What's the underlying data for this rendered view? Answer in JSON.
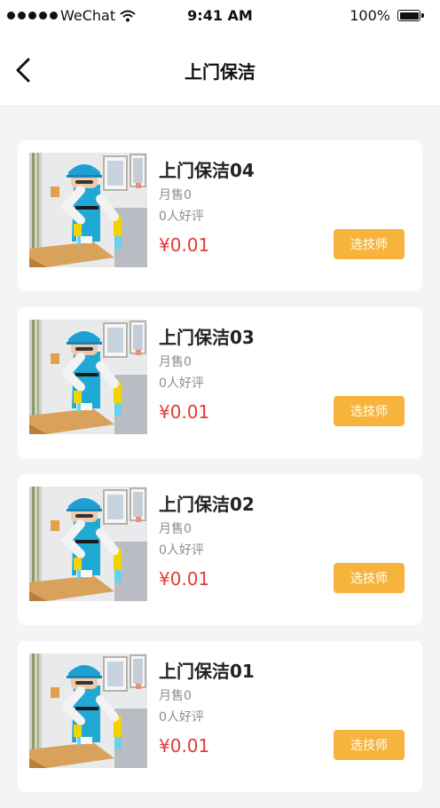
{
  "status_bar": {
    "carrier": "WeChat",
    "time": "9:41 AM",
    "battery": "100%"
  },
  "nav": {
    "title": "上门保洁",
    "back_icon": "chevron-left-icon"
  },
  "services": [
    {
      "name": "上门保洁04",
      "sales": "月售0",
      "reviews": "0人好评",
      "price": "¥0.01",
      "button": "选技师"
    },
    {
      "name": "上门保洁03",
      "sales": "月售0",
      "reviews": "0人好评",
      "price": "¥0.01",
      "button": "选技师"
    },
    {
      "name": "上门保洁02",
      "sales": "月售0",
      "reviews": "0人好评",
      "price": "¥0.01",
      "button": "选技师"
    },
    {
      "name": "上门保洁01",
      "sales": "月售0",
      "reviews": "0人好评",
      "price": "¥0.01",
      "button": "选技师"
    }
  ],
  "colors": {
    "accent": "#f7b43c",
    "price": "#e53935",
    "background": "#f4f4f6"
  }
}
